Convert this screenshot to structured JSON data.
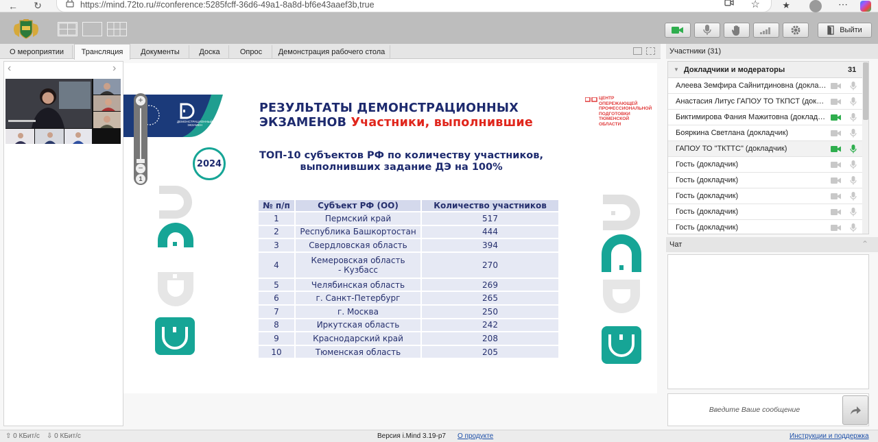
{
  "browser": {
    "url": "https://mind.72to.ru/#conference:5285fcff-36d6-49a1-8a8d-bf6e43aaef3b,true"
  },
  "toolbar": {
    "exit_label": "Выйти"
  },
  "tabs": [
    {
      "label": "О мероприятии"
    },
    {
      "label": "Трансляция"
    },
    {
      "label": "Документы"
    },
    {
      "label": "Доска"
    },
    {
      "label": "Опрос"
    },
    {
      "label": "Демонстрация рабочего стола"
    }
  ],
  "slide": {
    "left_logo_text": "ДЕМОНСТРАЦИОННЫЙ ЭКЗАМЕН",
    "title_line1": "РЕЗУЛЬТАТЫ ДЕМОНСТРАЦИОННЫХ",
    "title_line2_a": "ЭКЗАМЕНОВ ",
    "title_line2_b": "Участники, выполнившие",
    "badge": "2024",
    "subtitle_line1": "ТОП-10 субъектов РФ по количеству участников,",
    "subtitle_line2": "выполнивших задание ДЭ на 100%",
    "center_logo_lines": [
      "ЦЕНТР",
      "ОПЕРЕЖАЮЩЕЙ",
      "ПРОФЕССИОНАЛЬНОЙ",
      "ПОДГОТОВКИ",
      "ТЮМЕНСКОЙ ОБЛАСТИ"
    ],
    "table_headers": [
      "№ п/п",
      "Субъект РФ (ОО)",
      "Количество участников"
    ],
    "table_rows": [
      [
        "1",
        "Пермский край",
        "517"
      ],
      [
        "2",
        "Республика Башкортостан",
        "444"
      ],
      [
        "3",
        "Свердловская область",
        "394"
      ],
      [
        "4",
        "Кемеровская область - Кузбасс",
        "270"
      ],
      [
        "5",
        "Челябинская область",
        "269"
      ],
      [
        "6",
        "г. Санкт-Петербург",
        "265"
      ],
      [
        "7",
        "г. Москва",
        "250"
      ],
      [
        "8",
        "Иркутская область",
        "242"
      ],
      [
        "9",
        "Краснодарский край",
        "208"
      ],
      [
        "10",
        "Тюменская область",
        "205"
      ]
    ]
  },
  "participants": {
    "header": "Участники (31)",
    "group_label": "Докладчики и модераторы",
    "group_count": "31",
    "items": [
      {
        "name": "Алеева Земфира Сайнитдиновна (докладчик)",
        "cam_on": false,
        "mic_on": false
      },
      {
        "name": "Анастасия Литус ГАПОУ ТО ТКПСТ (докладчик)",
        "cam_on": false,
        "mic_on": false
      },
      {
        "name": "Биктимирова Фания Мажитовна (докладчик)",
        "cam_on": true,
        "mic_on": false
      },
      {
        "name": "Бояркина Светлана (докладчик)",
        "cam_on": false,
        "mic_on": false
      },
      {
        "name": "ГАПОУ ТО \"ТКТТС\" (докладчик)",
        "cam_on": true,
        "mic_on": true
      },
      {
        "name": "Гость (докладчик)",
        "cam_on": false,
        "mic_on": false
      },
      {
        "name": "Гость (докладчик)",
        "cam_on": false,
        "mic_on": false
      },
      {
        "name": "Гость (докладчик)",
        "cam_on": false,
        "mic_on": false
      },
      {
        "name": "Гость (докладчик)",
        "cam_on": false,
        "mic_on": false
      },
      {
        "name": "Гость (докладчик)",
        "cam_on": false,
        "mic_on": false
      }
    ]
  },
  "chat": {
    "header": "Чат",
    "placeholder": "Введите Ваше сообщение"
  },
  "status": {
    "upload": "0 КБит/с",
    "download": "0 КБит/с",
    "version": "Версия i.Mind 3.19-p7",
    "about": "О продукте",
    "help": "Инструкции и поддержка"
  },
  "colors": {
    "accent_green": "#2fae4e",
    "slide_navy": "#1d2a6e",
    "slide_red": "#e0261c",
    "slide_teal": "#16a596"
  }
}
